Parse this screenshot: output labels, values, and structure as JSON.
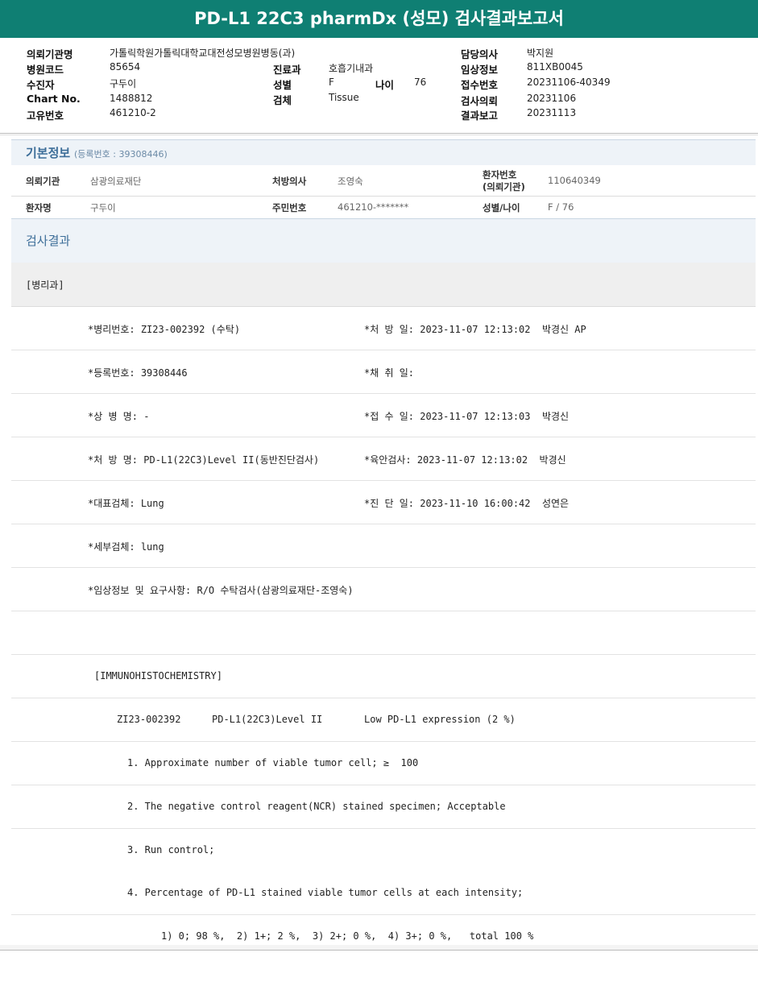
{
  "title": "PD-L1 22C3 pharmDx (성모) 검사결과보고서",
  "header": {
    "req_inst_label": "의뢰기관명",
    "req_inst": "가톨릭학원가톨릭대학교대전성모병원병동(과)",
    "hosp_code_label": "병원코드",
    "hosp_code": "85654",
    "dept_label": "진료과",
    "dept": "호흡기내과",
    "receiver_label": "수진자",
    "receiver": "구두이",
    "sex_label": "성별",
    "sex": "F",
    "age_label": "나이",
    "age": "76",
    "chart_label": "Chart No.",
    "chart": "1488812",
    "specimen_label": "검체",
    "specimen": "Tissue",
    "unique_label": "고유번호",
    "unique": "461210-2",
    "doctor_label": "담당의사",
    "doctor": "박지원",
    "clinical_label": "임상정보",
    "clinical": "811XB0045",
    "accept_label": "접수번호",
    "accept": "20231106-40349",
    "request_label": "검사의뢰",
    "request": "20231106",
    "report_label": "결과보고",
    "report": "20231113"
  },
  "basic": {
    "title": "기본정보",
    "reg": "(등록번호 : 39308446)",
    "row1": {
      "inst_label": "의뢰기관",
      "inst": "삼광의료재단",
      "prescriber_label": "처방의사",
      "prescriber": "조영숙",
      "pid_label1": "환자번호",
      "pid_label2": "(의뢰기관)",
      "pid": "110640349"
    },
    "row2": {
      "name_label": "환자명",
      "name": "구두이",
      "rrn_label": "주민번호",
      "rrn": "461210-*******",
      "sexage_label": "성별/나이",
      "sexage": "F / 76"
    }
  },
  "results": {
    "title": "검사결과",
    "dept": "[병리과]",
    "rows": [
      {
        "left": "*병리번호: ZI23-002392 (수탁)",
        "right": "*처 방 일: 2023-11-07 12:13:02  박경신 AP"
      },
      {
        "left": "*등록번호: 39308446",
        "right": "*채 취 일:"
      },
      {
        "left": "*상 병 명: -",
        "right": "*접 수 일: 2023-11-07 12:13:03  박경신"
      },
      {
        "left": "*처 방 명: PD-L1(22C3)Level II(동반진단검사)",
        "right": "*육안검사: 2023-11-07 12:13:02  박경신"
      },
      {
        "left": "*대표검체: Lung",
        "right": "*진 단 일: 2023-11-10 16:00:42  성연은"
      },
      {
        "left": "*세부검체: lung",
        "right": ""
      },
      {
        "left": "*임상정보 및 요구사항: R/O 수탁검사(삼광의료재단-조영숙)",
        "right": ""
      }
    ],
    "ihc_header": "[IMMUNOHISTOCHEMISTRY]",
    "ihc_line": {
      "id": "ZI23-002392",
      "test": "PD-L1(22C3)Level II",
      "result": "Low PD-L1 expression (2 %)"
    },
    "items": [
      "1. Approximate number of viable tumor cell; ≥  100",
      "2. The negative control reagent(NCR) stained specimen; Acceptable",
      "3. Run control;",
      "4. Percentage of PD-L1 stained viable tumor cells at each intensity;"
    ],
    "intensity": "1) 0; 98 %,  2) 1+; 2 %,  3) 2+; 0 %,  4) 3+; 0 %,   total 100 %"
  }
}
